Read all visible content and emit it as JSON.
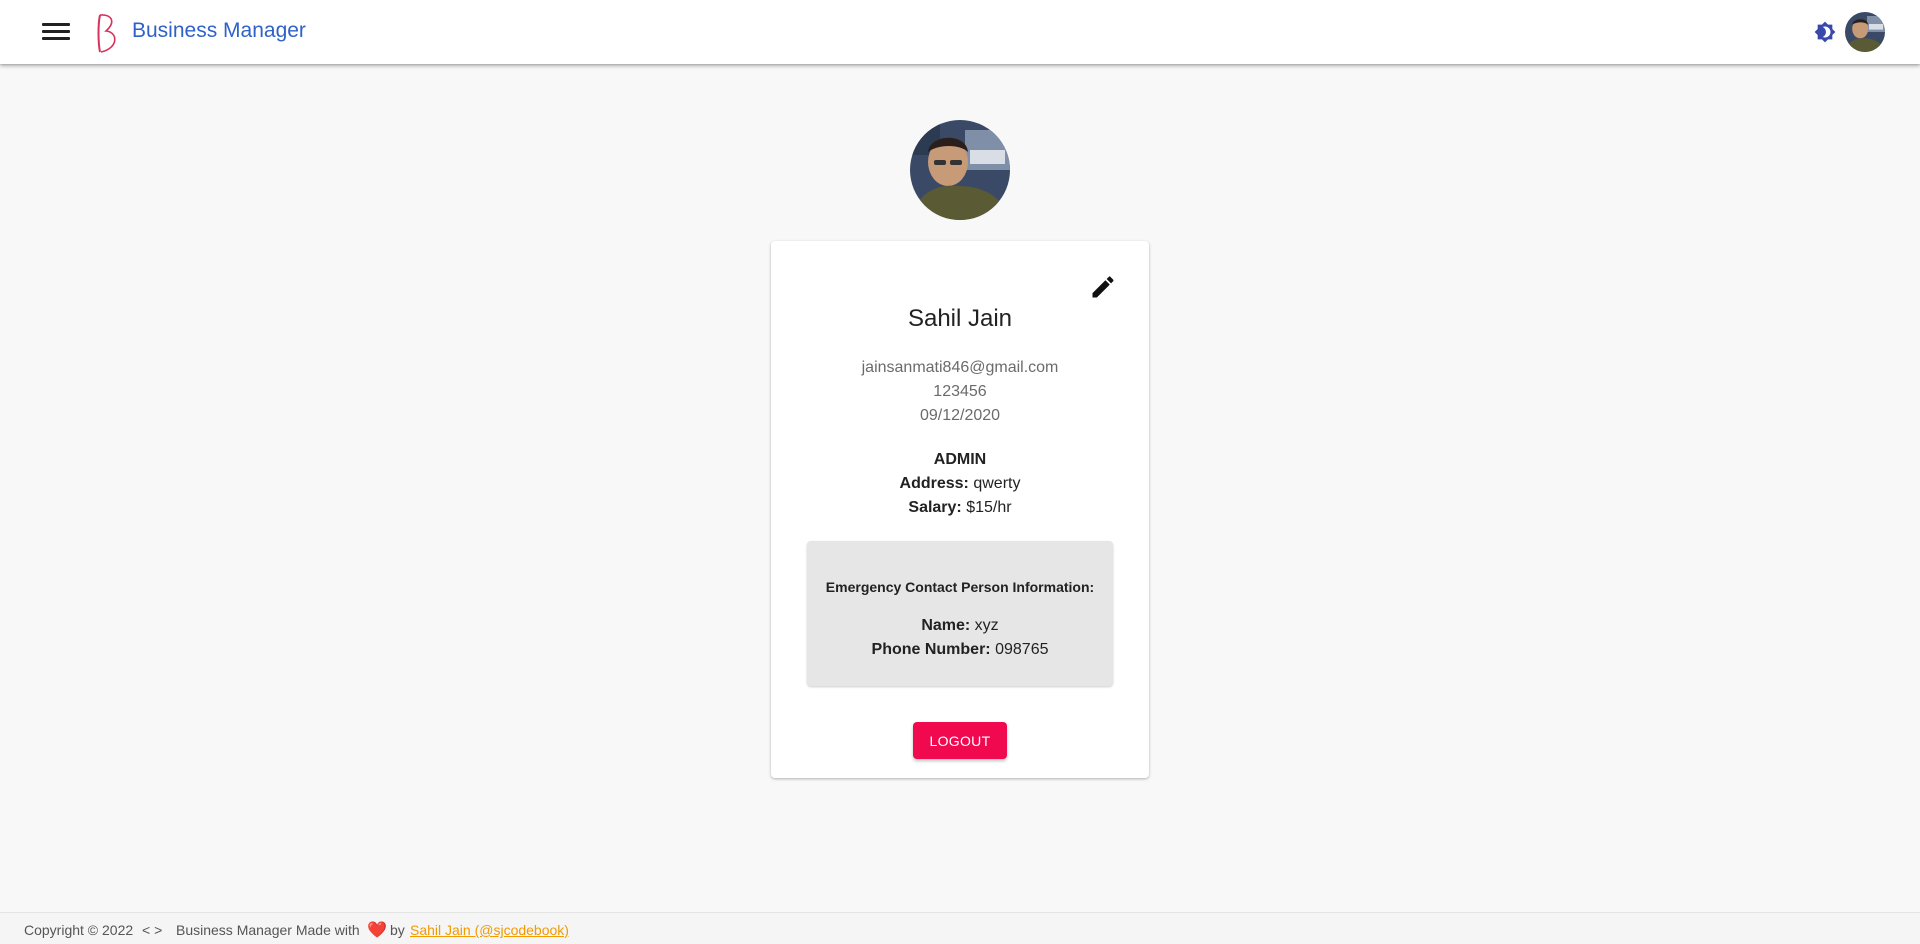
{
  "header": {
    "brand_title": "Business Manager",
    "accent_color": "#2f62c9",
    "logo_color": "#d6335a",
    "icons": [
      "menu-icon",
      "logo-icon",
      "theme-toggle-icon",
      "user-avatar"
    ]
  },
  "profile": {
    "name": "Sahil Jain",
    "email": "jainsanmati846@gmail.com",
    "phone": "123456",
    "date": "09/12/2020",
    "role": "ADMIN",
    "address_label": "Address:",
    "address": "qwerty",
    "salary_label": "Salary:",
    "salary": "$15/hr"
  },
  "emergency": {
    "title": "Emergency Contact Person Information:",
    "name_label": "Name:",
    "name": "xyz",
    "phone_label": "Phone Number:",
    "phone": "098765"
  },
  "actions": {
    "logout_label": "LOGOUT",
    "logout_color": "#f0094f"
  },
  "footer": {
    "copyright": "Copyright © 2022",
    "code_symbol": "< >",
    "made_with": "Business Manager Made with",
    "heart": "❤️",
    "by": "by",
    "author_link": "Sahil Jain (@sjcodebook)",
    "link_color": "#f29a00"
  }
}
